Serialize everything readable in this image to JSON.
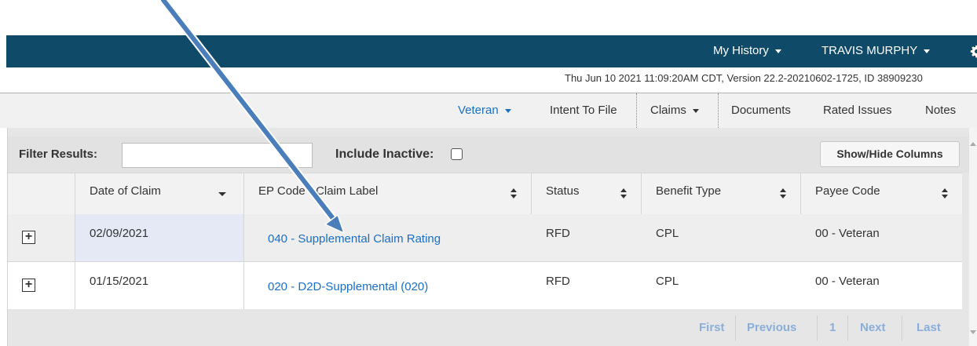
{
  "topbar": {
    "history": "My History",
    "user": "TRAVIS MURPHY"
  },
  "info": "Thu Jun 10 2021 11:09:20AM CDT, Version 22.2-20210602-1725, ID 38909230",
  "nav": {
    "veteran": "Veteran",
    "intent": "Intent To File",
    "claims": "Claims",
    "documents": "Documents",
    "rated": "Rated Issues",
    "notes": "Notes"
  },
  "filter": {
    "label": "Filter Results:",
    "value": "",
    "inactive_label": "Include Inactive:",
    "show_hide": "Show/Hide Columns"
  },
  "table": {
    "headers": [
      "Date of Claim",
      "EP Code - Claim Label",
      "Status",
      "Benefit Type",
      "Payee Code"
    ],
    "rows": [
      {
        "date": "02/09/2021",
        "claim": "040 - Supplemental Claim Rating",
        "status": "RFD",
        "benefit": "CPL",
        "payee": "00 - Veteran"
      },
      {
        "date": "01/15/2021",
        "claim": "020 - D2D-Supplemental (020)",
        "status": "RFD",
        "benefit": "CPL",
        "payee": "00 - Veteran"
      }
    ]
  },
  "pager": {
    "first": "First",
    "previous": "Previous",
    "page": "1",
    "next": "Next",
    "last": "Last"
  },
  "colors": {
    "topbar": "#0f4a68",
    "link": "#1a6fc4",
    "arrow": "#4a7ebb"
  }
}
